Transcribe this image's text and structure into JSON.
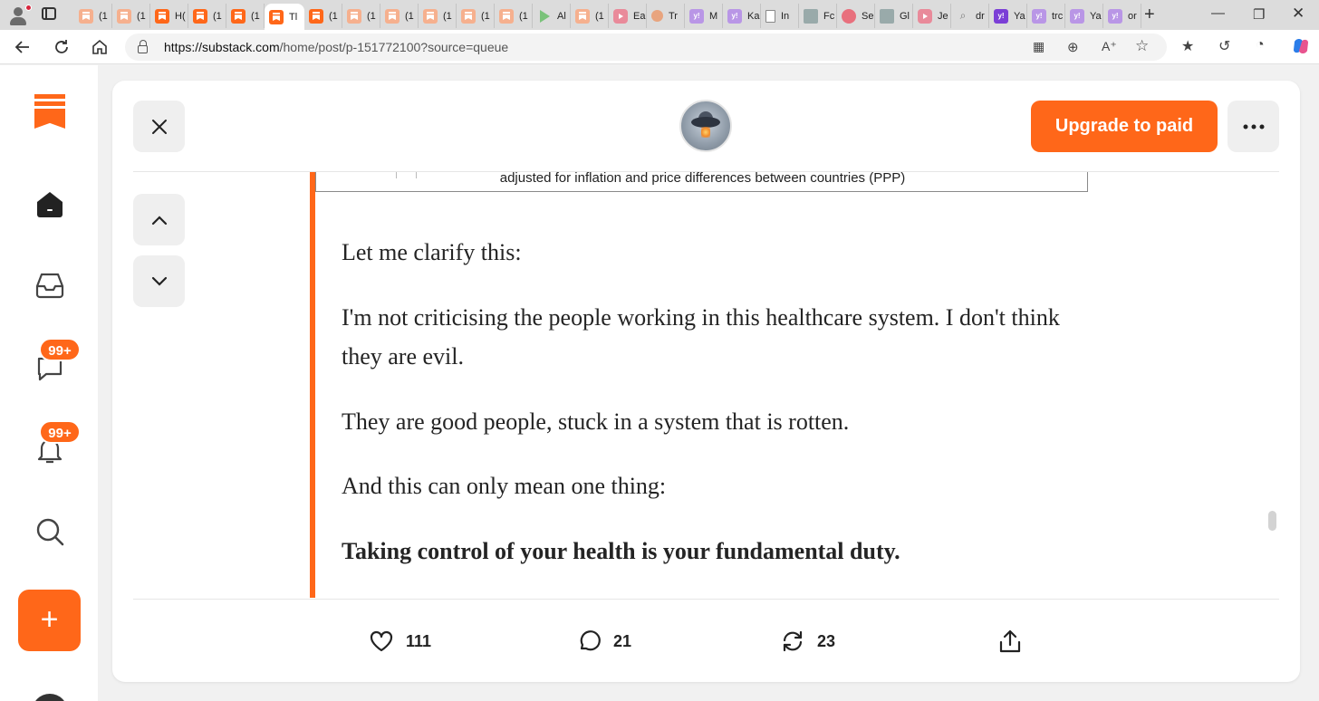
{
  "browser": {
    "tabs": [
      {
        "label": "(1",
        "icon": "substack-light"
      },
      {
        "label": "(1",
        "icon": "substack-light"
      },
      {
        "label": "H(",
        "icon": "substack"
      },
      {
        "label": "(1",
        "icon": "substack"
      },
      {
        "label": "(1",
        "icon": "substack"
      },
      {
        "label": "Tl",
        "icon": "substack",
        "active": true
      },
      {
        "label": "(1",
        "icon": "substack"
      },
      {
        "label": "(1",
        "icon": "substack-light"
      },
      {
        "label": "(1",
        "icon": "substack-light"
      },
      {
        "label": "(1",
        "icon": "substack-light"
      },
      {
        "label": "(1",
        "icon": "substack-light"
      },
      {
        "label": "(1",
        "icon": "substack-light"
      },
      {
        "label": "Al",
        "icon": "play"
      },
      {
        "label": "(1",
        "icon": "substack-light"
      },
      {
        "label": "Ea",
        "icon": "yt"
      },
      {
        "label": "Tr",
        "icon": "circle"
      },
      {
        "label": "M",
        "icon": "yahoo-light"
      },
      {
        "label": "Ka",
        "icon": "yahoo-light"
      },
      {
        "label": "In",
        "icon": "doc"
      },
      {
        "label": "Fc",
        "icon": "grey"
      },
      {
        "label": "Se",
        "icon": "red"
      },
      {
        "label": "Gl",
        "icon": "grey"
      },
      {
        "label": "Je",
        "icon": "yt"
      },
      {
        "label": "dr",
        "icon": "search"
      },
      {
        "label": "Ya",
        "icon": "yahoo"
      },
      {
        "label": "trc",
        "icon": "yahoo-light"
      },
      {
        "label": "Ya",
        "icon": "yahoo-light"
      },
      {
        "label": "or",
        "icon": "yahoo-light"
      }
    ],
    "yahoo_glyph": "y!",
    "url_host": "https://substack.com",
    "url_path": "/home/post/p-151772100?source=queue"
  },
  "sidebar": {
    "messages_badge": "99+",
    "notifications_badge": "99+"
  },
  "post": {
    "upgrade_label": "Upgrade to paid",
    "image_caption": "adjusted for inflation and price differences between countries (PPP)",
    "paragraphs": [
      "Let me clarify this:",
      "I'm not criticising the people working in this healthcare system. I don't think they are evil.",
      "They are good people, stuck in a system that is rotten.",
      "And this can only mean one thing:"
    ],
    "bold_paragraph": "Taking control of your health is your fundamental duty."
  },
  "actions": {
    "likes": "111",
    "comments": "21",
    "restacks": "23"
  },
  "colors": {
    "accent": "#ff6719"
  }
}
